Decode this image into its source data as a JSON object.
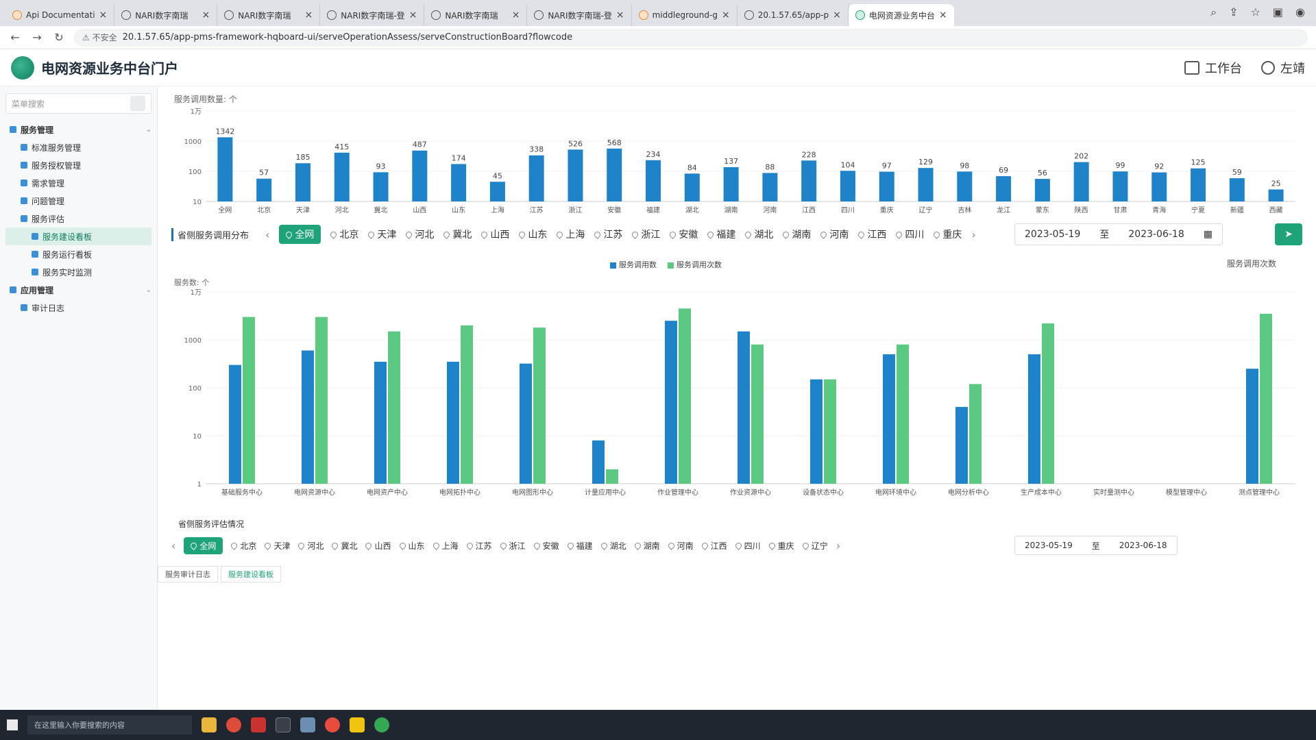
{
  "browser": {
    "tabs": [
      {
        "title": "Api Documentati",
        "icon": "orange"
      },
      {
        "title": "NARI数字南瑞",
        "icon": "globe"
      },
      {
        "title": "NARI数字南瑞",
        "icon": "globe"
      },
      {
        "title": "NARI数字南瑞-登",
        "icon": "globe"
      },
      {
        "title": "NARI数字南瑞",
        "icon": "globe"
      },
      {
        "title": "NARI数字南瑞-登",
        "icon": "globe"
      },
      {
        "title": "middleground-g",
        "icon": "orange"
      },
      {
        "title": "20.1.57.65/app-p",
        "icon": "globe"
      },
      {
        "title": "电网资源业务中台",
        "icon": "green",
        "active": true
      }
    ],
    "security_label": "不安全",
    "url": "20.1.57.65/app-pms-framework-hqboard-ui/serveOperationAssess/serveConstructionBoard?flowcode"
  },
  "header": {
    "title": "电网资源业务中台门户",
    "workbench": "工作台",
    "user": "左靖"
  },
  "sidebar": {
    "search_placeholder": "菜单搜索",
    "items": [
      {
        "label": "服务管理",
        "level": 1
      },
      {
        "label": "标准服务管理",
        "level": 2
      },
      {
        "label": "服务授权管理",
        "level": 2
      },
      {
        "label": "需求管理",
        "level": 2
      },
      {
        "label": "问题管理",
        "level": 2
      },
      {
        "label": "服务评估",
        "level": 2
      },
      {
        "label": "服务建设看板",
        "level": 3,
        "active": true
      },
      {
        "label": "服务运行看板",
        "level": 3
      },
      {
        "label": "服务实时监测",
        "level": 3
      },
      {
        "label": "应用管理",
        "level": 1
      },
      {
        "label": "审计日志",
        "level": 2
      }
    ]
  },
  "top_chart_title": "服务调用数量: 个",
  "bottom_chart": {
    "section_title": "省侧服务调用分布",
    "regions": [
      "全网",
      "北京",
      "天津",
      "河北",
      "冀北",
      "山西",
      "山东",
      "上海",
      "江苏",
      "浙江",
      "安徽",
      "福建",
      "湖北",
      "湖南",
      "河南",
      "江西",
      "四川",
      "重庆"
    ],
    "date_from": "2023-05-19",
    "date_sep": "至",
    "date_to": "2023-06-18",
    "legend": [
      "服务调用数",
      "服务调用次数"
    ],
    "left_axis_label": "服务数: 个",
    "right_axis_label": "服务调用次数"
  },
  "eval_section": {
    "title": "省侧服务评估情况",
    "regions": [
      "全网",
      "北京",
      "天津",
      "河北",
      "冀北",
      "山西",
      "山东",
      "上海",
      "江苏",
      "浙江",
      "安徽",
      "福建",
      "湖北",
      "湖南",
      "河南",
      "江西",
      "四川",
      "重庆",
      "辽宁"
    ],
    "date_from": "2023-05-19",
    "date_sep": "至",
    "date_to": "2023-06-18"
  },
  "taskbar": {
    "search_placeholder": "在这里输入你要搜索的内容",
    "page_tabs": [
      "服务审计日志",
      "服务建设看板"
    ]
  },
  "colors": {
    "bar_blue": "#1f83c9",
    "bar_green": "#5cc983",
    "accent": "#1fa37a"
  },
  "chart_data": [
    {
      "type": "bar",
      "title": "服务调用数量: 个",
      "yscale": "log",
      "yticks": [
        "10",
        "100",
        "1000",
        "1万"
      ],
      "categories": [
        "全网",
        "北京",
        "天津",
        "河北",
        "冀北",
        "山西",
        "山东",
        "上海",
        "江苏",
        "浙江",
        "安徽",
        "福建",
        "湖北",
        "湖南",
        "河南",
        "江西",
        "四川",
        "重庆",
        "辽宁",
        "吉林",
        "龙江",
        "蒙东",
        "陕西",
        "甘肃",
        "青海",
        "宁夏",
        "新疆",
        "西藏"
      ],
      "values": [
        1342,
        57,
        185,
        415,
        93,
        487,
        174,
        45,
        338,
        526,
        568,
        234,
        84,
        137,
        88,
        228,
        104,
        97,
        129,
        98,
        69,
        56,
        202,
        99,
        92,
        125,
        59,
        25
      ]
    },
    {
      "type": "bar",
      "yscale": "log",
      "ylabel": "服务数: 个",
      "yticks": [
        "1",
        "10",
        "100",
        "1000",
        "1万"
      ],
      "categories": [
        "基础服务中心",
        "电网资源中心",
        "电网资产中心",
        "电网拓扑中心",
        "电网图形中心",
        "计量应用中心",
        "作业管理中心",
        "作业资源中心",
        "设备状态中心",
        "电网环境中心",
        "电网分析中心",
        "生产成本中心",
        "实时量测中心",
        "模型管理中心",
        "测点管理中心"
      ],
      "series": [
        {
          "name": "服务调用数",
          "values": [
            300,
            600,
            350,
            350,
            320,
            8,
            2500,
            1500,
            150,
            500,
            40,
            500,
            0,
            0,
            250
          ]
        },
        {
          "name": "服务调用次数",
          "values": [
            3000,
            3000,
            1500,
            2000,
            1800,
            2,
            4500,
            800,
            150,
            800,
            120,
            2200,
            0,
            0,
            3500
          ]
        }
      ]
    }
  ]
}
